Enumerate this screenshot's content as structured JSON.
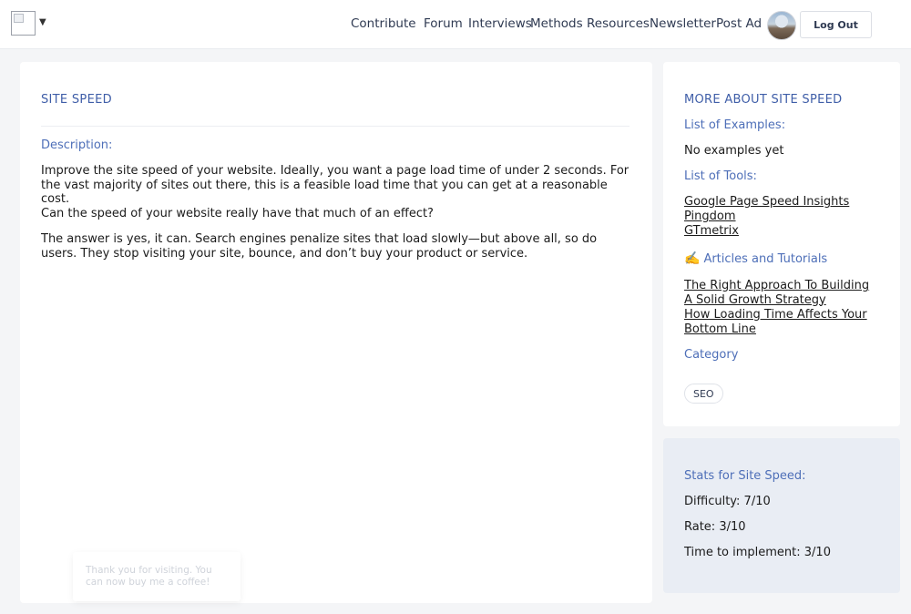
{
  "header": {
    "nav": [
      {
        "label": "Contribute",
        "key": "contribute"
      },
      {
        "label": "Forum",
        "key": "forum"
      },
      {
        "label": "Interviews",
        "key": "interviews"
      },
      {
        "label": "Methods",
        "key": "methods"
      },
      {
        "label": "Resources",
        "key": "resources"
      },
      {
        "label": "Newsletter",
        "key": "newsletter"
      },
      {
        "label": "Post Ad",
        "key": "post-ad"
      }
    ],
    "logout_label": "Log Out",
    "logo_icon": "broken-image-icon",
    "menu_icon": "chevron-down-icon"
  },
  "main": {
    "title": "SITE SPEED",
    "description_label": "Description:",
    "paragraphs": [
      "Improve the site speed of your website. Ideally, you want a page load time of under 2 seconds. For the vast majority of sites out there, this is a feasible load time that you can get at a reasonable cost.",
      "Can the speed of your website really have that much of an effect?",
      "The answer is yes, it can. Search engines penalize sites that load slowly—but above all, so do users. They stop visiting your site, bounce, and don’t buy your product or service."
    ]
  },
  "toast": {
    "text": "Thank you for visiting. You can now buy me a coffee!"
  },
  "sidebar": {
    "title": "MORE ABOUT SITE SPEED",
    "examples_label": "List of Examples:",
    "examples_empty": "No examples yet",
    "tools_label": "List of Tools:",
    "tools": [
      "Google Page Speed Insights",
      "Pingdom",
      "GTmetrix"
    ],
    "articles_icon": "✍️",
    "articles_label": "Articles and Tutorials",
    "articles": [
      "The Right Approach To Building A Solid Growth Strategy",
      "How Loading Time Affects Your Bottom Line"
    ],
    "category_label": "Category",
    "category_tag": "SEO"
  },
  "stats": {
    "title": "Stats for Site Speed:",
    "difficulty": "Difficulty: 7/10",
    "rate": "Rate: 3/10",
    "time": "Time to implement: 3/10"
  },
  "colors": {
    "accent": "#4e6fb8",
    "heading": "#3f5ea8",
    "stats_bg": "#e9edf4"
  }
}
